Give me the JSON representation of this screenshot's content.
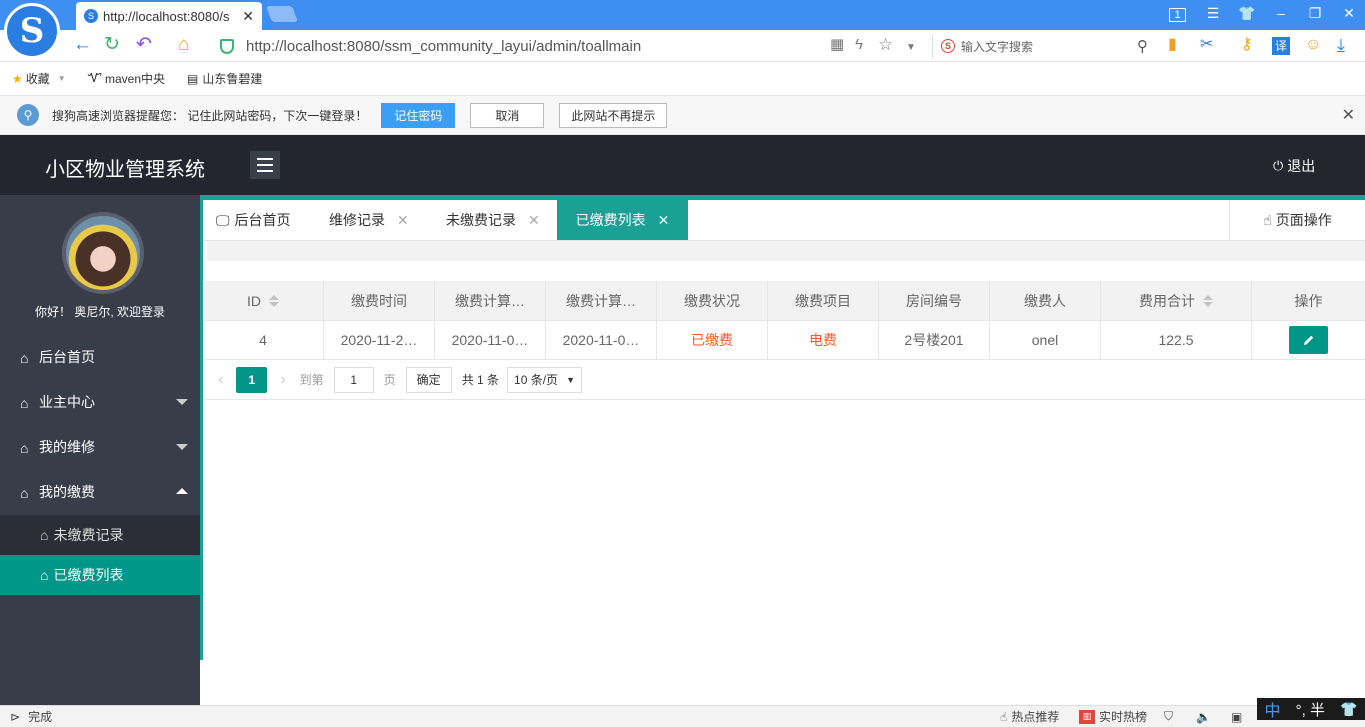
{
  "browser": {
    "tab_title": "http://localhost:8080/s",
    "url": "http://localhost:8080/ssm_community_layui/admin/toallmain",
    "search_placeholder": "输入文字搜索",
    "logo_char": "S",
    "bookmarks": [
      {
        "label": "收藏",
        "icon": "star-icon"
      },
      {
        "label": "maven中央",
        "icon": "maven-icon"
      },
      {
        "label": "山东鲁碧建",
        "icon": "document-icon"
      }
    ],
    "notice": {
      "text": "搜狗高速浏览器提醒您： 记住此网站密码，下次一键登录！",
      "btn_remember": "记住密码",
      "btn_cancel": "取消",
      "btn_never": "此网站不再提示"
    },
    "status": {
      "left": "完成",
      "hot": "热点推荐",
      "realtime": "实时热榜",
      "ime": "°, 半"
    }
  },
  "app": {
    "title": "小区物业管理系统",
    "logout": "退出",
    "welcome": "你好！ 奥尼尔, 欢迎登录"
  },
  "sidebar": {
    "items": [
      {
        "label": "后台首页"
      },
      {
        "label": "业主中心"
      },
      {
        "label": "我的维修"
      },
      {
        "label": "我的缴费"
      }
    ],
    "sub_items": [
      {
        "label": "未缴费记录"
      },
      {
        "label": "已缴费列表"
      }
    ]
  },
  "tabs": {
    "home": "后台首页",
    "repair": "维修记录",
    "unpaid": "未缴费记录",
    "paid": "已缴费列表",
    "page_ops": "页面操作"
  },
  "table": {
    "headers": [
      "ID",
      "缴费时间",
      "缴费计算…",
      "缴费计算…",
      "缴费状况",
      "缴费项目",
      "房间编号",
      "缴费人",
      "费用合计",
      "操作"
    ],
    "rows": [
      [
        "4",
        "2020-11-2…",
        "2020-11-0…",
        "2020-11-0…",
        "已缴费",
        "电费",
        "2号楼201",
        "onel",
        "122.5"
      ]
    ],
    "colors": {
      "status": "#ff5722",
      "item": "#ff5722",
      "accent": "#009688"
    }
  },
  "pager": {
    "current": "1",
    "goto_label": "到第",
    "goto_value": "1",
    "page_unit": "页",
    "confirm": "确定",
    "total": "共 1 条",
    "per_page": "10 条/页"
  }
}
